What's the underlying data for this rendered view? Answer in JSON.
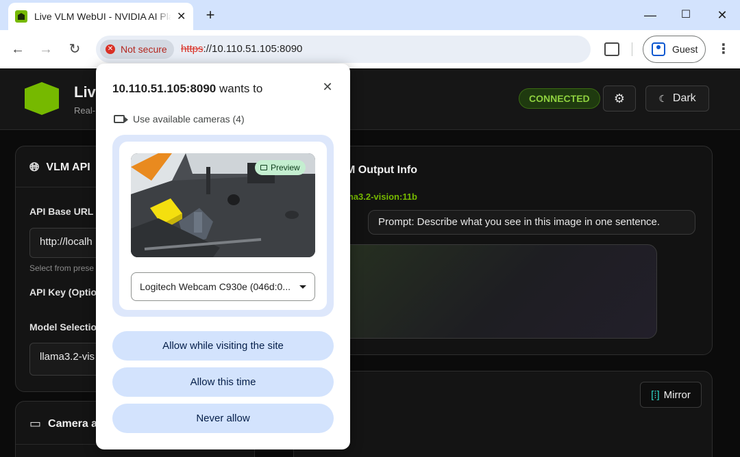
{
  "browser": {
    "tab_title": "Live VLM WebUI - NVIDIA AI Pla",
    "tab_close": "✕",
    "new_tab": "+",
    "window_minimize": "—",
    "window_maximize": "☐",
    "window_close": "✕",
    "security_chip": "Not secure",
    "url_protocol": "https",
    "url_rest": "://10.110.51.105:8090",
    "profile_label": "Guest"
  },
  "app": {
    "title": "Live",
    "subtitle": "Real-",
    "status_badge": "CONNECTED",
    "theme_toggle_label": "Dark",
    "accent_color": "#76b900"
  },
  "left_panel": {
    "title": "VLM API",
    "api_base_url_label": "API Base URL",
    "api_base_url_value": "http://localh",
    "api_base_url_helper": "Select from prese",
    "api_key_label": "API Key (Optio",
    "model_selection_label": "Model Selectio",
    "model_selection_value": "llama3.2-vis",
    "camera_title": "Camera a"
  },
  "right_panel": {
    "title": "M Output Info",
    "model_name": "ama3.2-vision:11b",
    "prompt": "Prompt: Describe what you see in this image in one sentence.",
    "mirror_label": "Mirror"
  },
  "permission_popup": {
    "origin": "10.110.51.105:8090",
    "title_suffix": " wants to",
    "close": "✕",
    "camera_request": "Use available cameras (4)",
    "preview_badge": "Preview",
    "selected_camera": "Logitech Webcam C930e (046d:0...",
    "buttons": {
      "allow_visiting": "Allow while visiting the site",
      "allow_once": "Allow this time",
      "never": "Never allow"
    }
  }
}
